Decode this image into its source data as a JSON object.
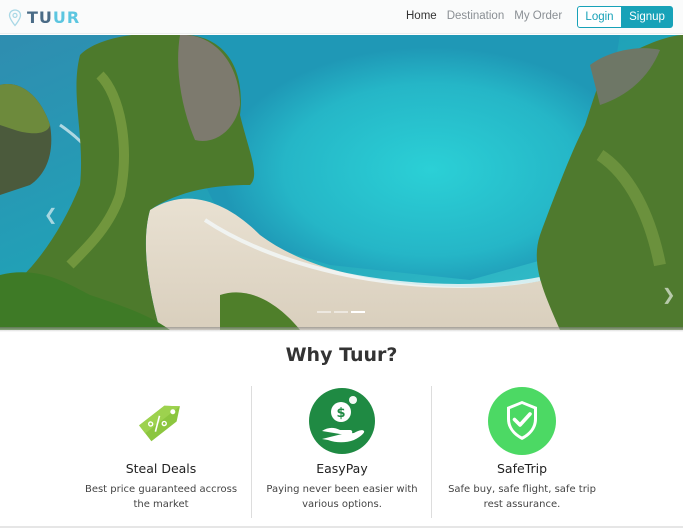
{
  "brand": {
    "name_main": "TU",
    "name_accent": "UR",
    "colors": {
      "dark": "#4a6b86",
      "accent": "#5cc6e0"
    },
    "icon": "map-pin-icon"
  },
  "nav": {
    "items": [
      {
        "label": "Home",
        "active": true
      },
      {
        "label": "Destination",
        "active": false
      },
      {
        "label": "My Order",
        "active": false
      }
    ],
    "login_label": "Login",
    "signup_label": "Signup",
    "accent_color": "#17a2b8"
  },
  "hero": {
    "prev_icon": "chevron-left-icon",
    "next_icon": "chevron-right-icon",
    "slides": 3,
    "active_slide": 3
  },
  "why": {
    "title": "Why Tuur?",
    "features": [
      {
        "title": "Steal Deals",
        "desc": "Best price guaranteed accross the market",
        "icon": "price-tag-icon",
        "color": "#8cc63f"
      },
      {
        "title": "EasyPay",
        "desc": "Paying never been easier with various options.",
        "icon": "money-hand-icon",
        "color": "#1f8a43"
      },
      {
        "title": "SafeTrip",
        "desc": "Safe buy, safe flight, safe trip rest assurance.",
        "icon": "shield-check-icon",
        "color": "#4cd964"
      }
    ]
  }
}
